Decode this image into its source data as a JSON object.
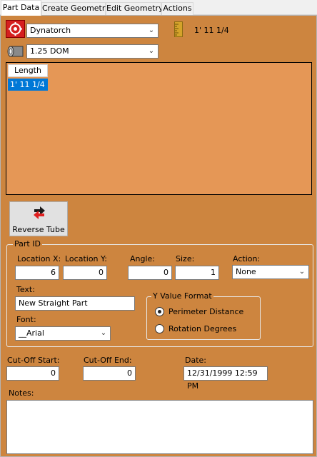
{
  "tabs": [
    {
      "label": "Part Data"
    },
    {
      "label": "Create Geometry"
    },
    {
      "label": "Edit Geometry"
    },
    {
      "label": "Actions"
    }
  ],
  "machine": {
    "value": "Dynatorch"
  },
  "tube": {
    "value": "1.25 DOM"
  },
  "length_readout": "1' 11 1/4",
  "length_list": {
    "header": "Length",
    "rows": [
      "1' 11 1/4"
    ]
  },
  "reverse_button": {
    "label": "Reverse Tube"
  },
  "part_id": {
    "title": "Part ID",
    "location_x": {
      "label": "Location X:",
      "value": "6"
    },
    "location_y": {
      "label": "Location Y:",
      "value": "0"
    },
    "angle": {
      "label": "Angle:",
      "value": "0"
    },
    "size": {
      "label": "Size:",
      "value": "1"
    },
    "action": {
      "label": "Action:",
      "value": "None"
    },
    "text": {
      "label": "Text:",
      "value": "New Straight Part"
    },
    "font": {
      "label": "Font:",
      "value": "__Arial"
    },
    "y_value_format": {
      "title": "Y Value Format",
      "options": [
        "Perimeter Distance",
        "Rotation Degrees"
      ],
      "selected": "Perimeter Distance"
    }
  },
  "cutoff_start": {
    "label": "Cut-Off Start:",
    "value": "0"
  },
  "cutoff_end": {
    "label": "Cut-Off End:",
    "value": "0"
  },
  "date": {
    "label": "Date:",
    "value": "12/31/1999 12:59 PM"
  },
  "notes": {
    "label": "Notes:",
    "value": ""
  },
  "colors": {
    "panel": "#cd853f",
    "list_bg": "#e59756",
    "selection": "#0078d7"
  }
}
